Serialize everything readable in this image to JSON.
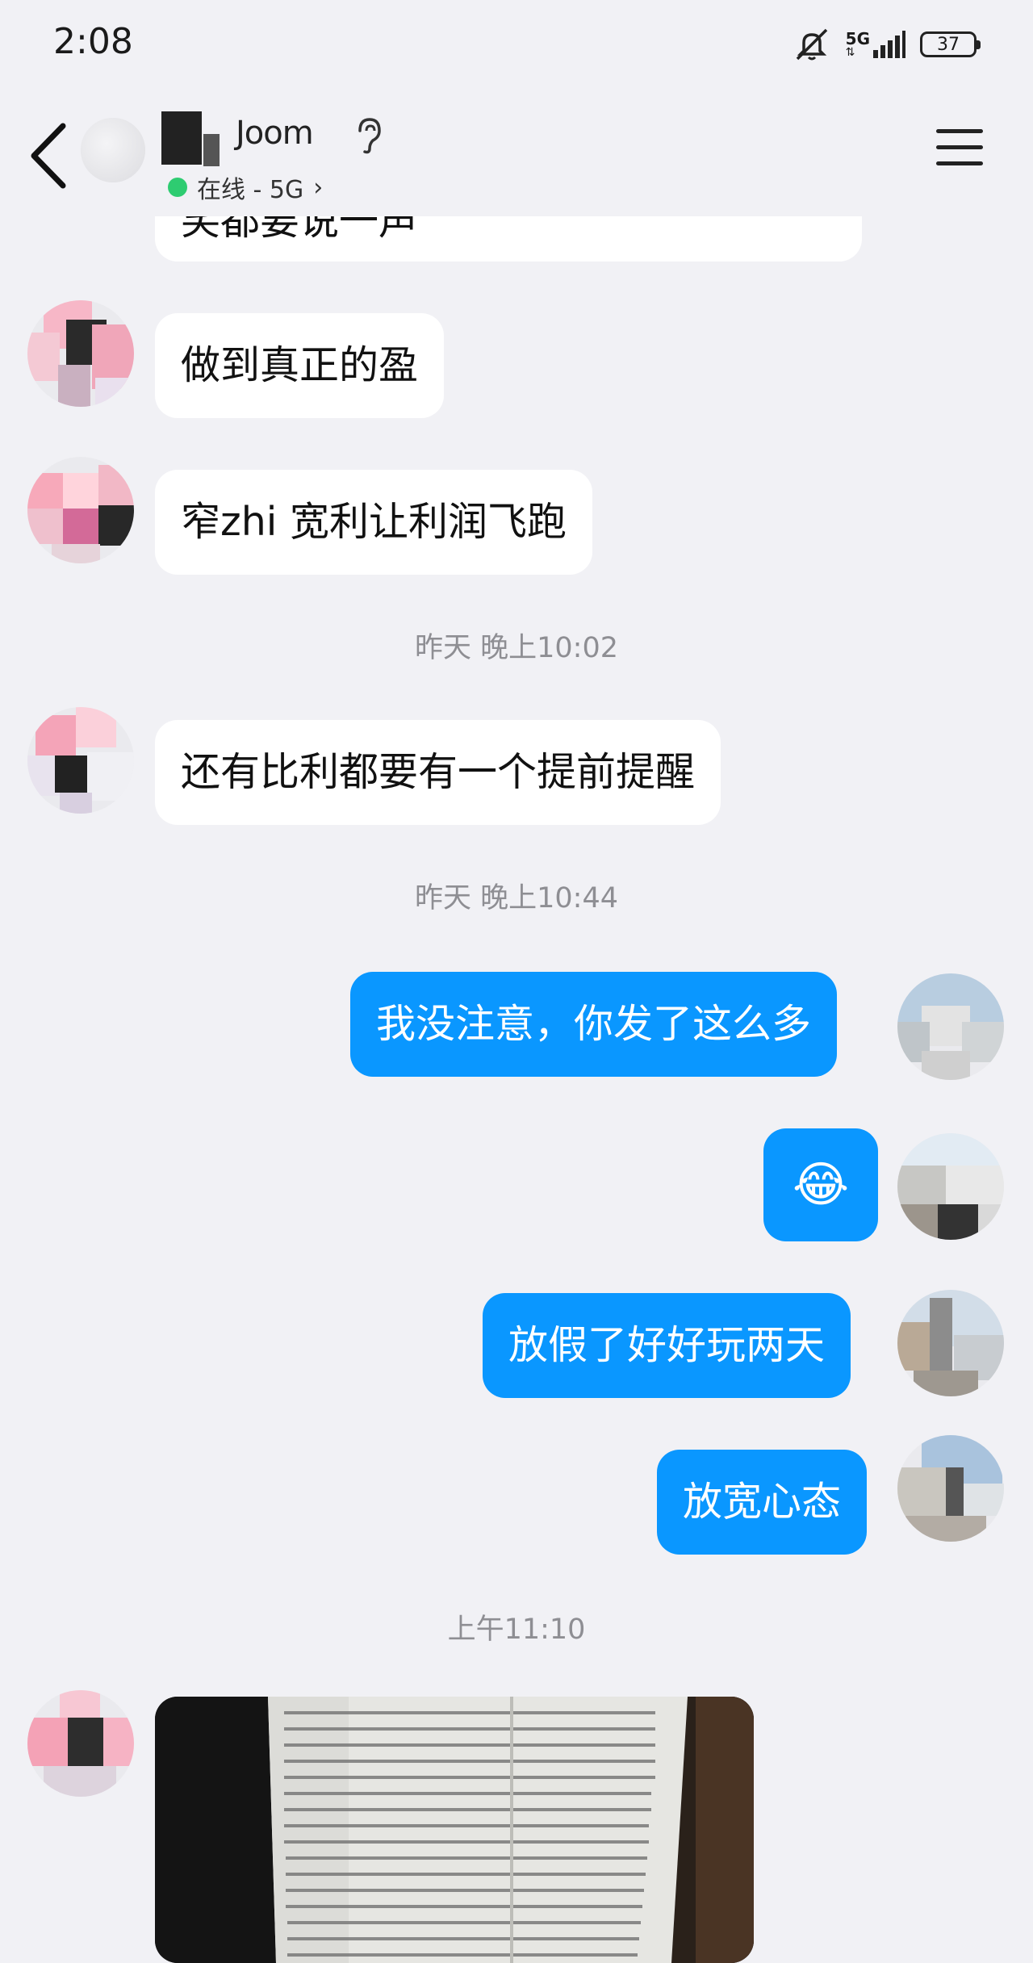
{
  "status_bar": {
    "time": "2:08",
    "network": "5G",
    "battery": "37"
  },
  "header": {
    "contact_name": "Joom",
    "presence": "在线 - 5G",
    "presence_color": "#2ecc71"
  },
  "messages": [
    {
      "side": "left",
      "text": "笑都要说一声"
    },
    {
      "side": "left",
      "text": "做到真正的盈"
    },
    {
      "side": "left",
      "text": "窄zhi 宽利让利润飞跑"
    },
    {
      "timestamp": "昨天 晚上10:02"
    },
    {
      "side": "left",
      "text": "还有比利都要有一个提前提醒"
    },
    {
      "timestamp": "昨天 晚上10:44"
    },
    {
      "side": "right",
      "text": "我没注意，你发了这么多"
    },
    {
      "side": "right",
      "text": "😂"
    },
    {
      "side": "right",
      "text": "放假了好好玩两天"
    },
    {
      "side": "right",
      "text": "放宽心态"
    },
    {
      "timestamp": "上午11:10"
    },
    {
      "side": "left",
      "type": "image"
    }
  ],
  "colors": {
    "background": "#f1f1f5",
    "outgoing_bubble": "#0a97ff",
    "incoming_bubble": "#ffffff",
    "timestamp_text": "#8e8e93"
  }
}
